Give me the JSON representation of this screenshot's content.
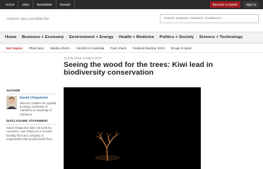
{
  "topnav": {
    "items": [
      "Home",
      "Jobs",
      "Newsletter",
      "Donate"
    ],
    "become_reader": "Become a reader",
    "sign_in": "Sign in"
  },
  "header": {
    "tagline": "Academic rigour, journalistic flair",
    "search_placeholder": "Search analysis, research, academics…"
  },
  "mainnav": {
    "items": [
      "Home",
      "Business + Economy",
      "Environment + Energy",
      "Health + Medicine",
      "Politics + Society",
      "Science + Technology"
    ]
  },
  "hot_topics": {
    "label": "Hot topics",
    "items": [
      "Pharmacy",
      "Media reform",
      "Alcohol in Australia",
      "Fact check",
      "Federal election 2013",
      "Drugs in sport"
    ]
  },
  "article": {
    "dateline": "13 July 2012, 6.25am AEST",
    "title": "Seeing the wood for the trees: Kiwi lead in biodiversity conservation"
  },
  "sidebar": {
    "author_heading": "AUTHOR",
    "author_name": "David Chiquemot",
    "author_role": "Director, Institute for Applied Ecology, University of Canberra at University of Canberra",
    "disclosure_heading": "DISCLOSURE STATEMENT",
    "disclosure_text": "David Chiquemot does not work for, consult to, own shares in or receive funding from any company or organisation that would benefit from"
  },
  "colors": {
    "topbar": "#2b2b2b",
    "accent_red": "#a11d21",
    "hot_topics": "#b42a2a",
    "link_blue": "#1f5f9c"
  }
}
